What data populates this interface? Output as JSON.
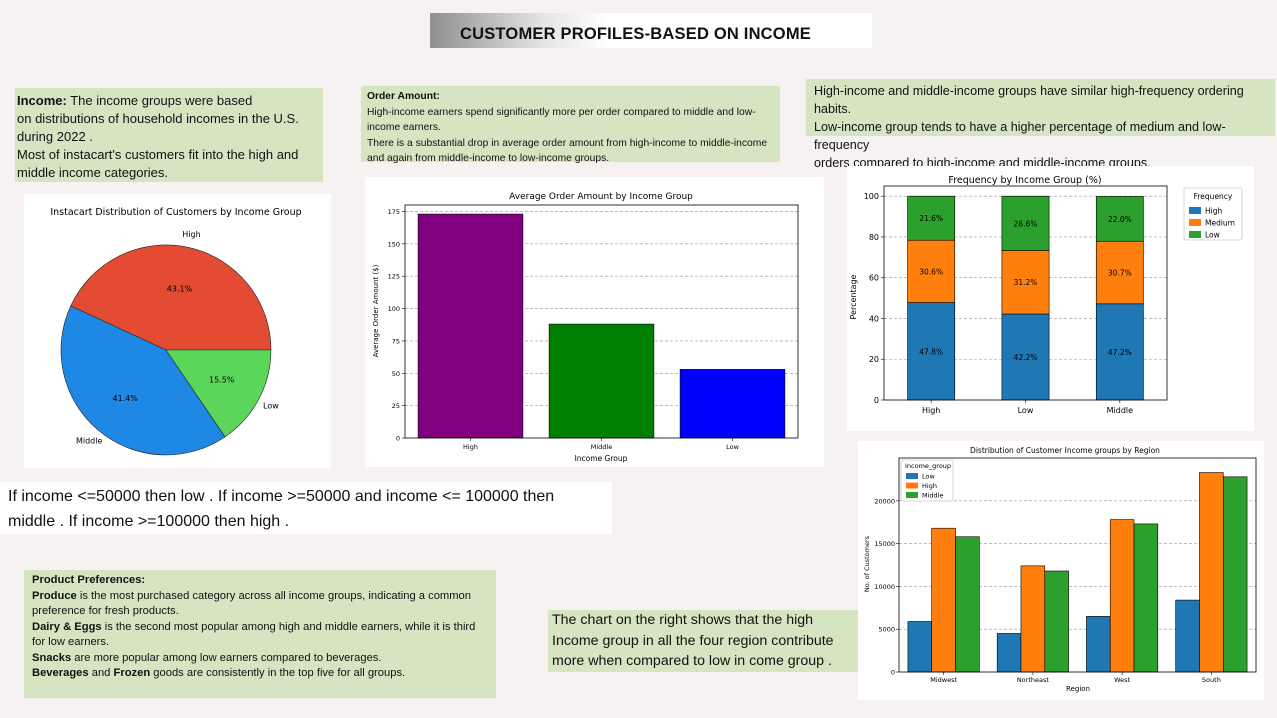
{
  "page_title": "CUSTOMER PROFILES-BASED ON INCOME",
  "income_note": {
    "heading": "Income:",
    "line1": " The income groups were based",
    "line2": "on  distributions of household incomes in the U.S.",
    "line3": "during 2022 .",
    "line4": "Most of instacart's customers fit into the high and",
    "line5": "middle income categories."
  },
  "order_note": {
    "heading": "Order Amount:",
    "line1": "High-income earners spend significantly more per order compared to middle and low-",
    "line2": "income earners.",
    "line3": "There is a substantial drop in average order amount from high-income to middle-income",
    "line4": "and again from middle-income to low-income groups."
  },
  "frequency_note": {
    "line1": "High-income and middle-income groups have similar high-frequency ordering habits.",
    "line2": "Low-income group tends to have a higher percentage of medium and low-frequency",
    "line3": "orders compared to high-income and middle-income groups."
  },
  "rule_note": {
    "line1": "If income <=50000 then low . If income >=50000 and income <= 100000 then",
    "line2": "middle . If income >=100000 then high ."
  },
  "product_note": {
    "heading": "Product Preferences:",
    "produce_bold": "Produce",
    "produce_text": " is the most purchased category across all income groups, indicating a common",
    "produce_text2": "preference for fresh products.",
    "dairy_bold": "Dairy & Eggs",
    "dairy_text": " is the second most popular among high and middle earners, while it is third",
    "dairy_text2": "for low earners.",
    "snacks_bold": "Snacks",
    "snacks_text": " are more popular among low earners compared to beverages.",
    "bev_bold": "Beverages",
    "bev_and": " and ",
    "frozen_bold": "Frozen",
    "bev_text": " goods are consistently in the top five for all groups."
  },
  "region_note": {
    "line1": "The chart on the right shows that the high",
    "line2": "Income group in all the four region contribute",
    "line3": "more when compared to low in come group ."
  },
  "chart_data": [
    {
      "type": "pie",
      "title": "Instacart Distribution of Customers by Income Group",
      "labels": [
        "High",
        "Middle",
        "Low"
      ],
      "values": [
        43.1,
        41.4,
        15.5
      ],
      "value_labels": [
        "43.1%",
        "41.4%",
        "15.5%"
      ],
      "colors": [
        "#e34c33",
        "#1f88e5",
        "#5bd65b"
      ]
    },
    {
      "type": "bar",
      "title": "Average Order Amount by Income Group",
      "categories": [
        "High",
        "Middle",
        "Low"
      ],
      "values": [
        173,
        88,
        53
      ],
      "colors": [
        "#800080",
        "#008000",
        "#0000ff"
      ],
      "xlabel": "Income Group",
      "ylabel": "Average Order Amount ($)",
      "ylim": [
        0,
        180
      ],
      "yticks": [
        0,
        25,
        50,
        75,
        100,
        125,
        150,
        175
      ],
      "grid": "horizontal dashed"
    },
    {
      "type": "bar",
      "stacked": true,
      "title": "Frequency by Income Group (%)",
      "categories": [
        "High",
        "Low",
        "Middle"
      ],
      "series": [
        {
          "name": "High",
          "values": [
            47.8,
            42.2,
            47.2
          ],
          "labels": [
            "47.8%",
            "42.2%",
            "47.2%"
          ],
          "color": "#1f77b4"
        },
        {
          "name": "Medium",
          "values": [
            30.6,
            31.2,
            30.7
          ],
          "labels": [
            "30.6%",
            "31.2%",
            "30.7%"
          ],
          "color": "#ff7f0e"
        },
        {
          "name": "Low",
          "values": [
            21.6,
            26.6,
            22.0
          ],
          "labels": [
            "21.6%",
            "26.6%",
            "22.0%"
          ],
          "color": "#2ca02c"
        }
      ],
      "ylabel": "Percentage",
      "ylim": [
        0,
        105
      ],
      "yticks": [
        0,
        20,
        40,
        60,
        80,
        100
      ],
      "legend_title": "Frequency",
      "legend_position": "right",
      "grid": "horizontal dashed"
    },
    {
      "type": "bar",
      "title": "Distribution of Customer Income groups by Region",
      "categories": [
        "Midwest",
        "Northeast",
        "West",
        "South"
      ],
      "series": [
        {
          "name": "Low",
          "values": [
            5900,
            4500,
            6500,
            8400
          ],
          "color": "#1f77b4"
        },
        {
          "name": "High",
          "values": [
            16800,
            12400,
            17800,
            23300
          ],
          "color": "#ff7f0e"
        },
        {
          "name": "Middle",
          "values": [
            15800,
            11800,
            17300,
            22800
          ],
          "color": "#2ca02c"
        }
      ],
      "xlabel": "Region",
      "ylabel": "No. of Customers",
      "ylim": [
        0,
        25000
      ],
      "yticks": [
        0,
        5000,
        10000,
        15000,
        20000
      ],
      "legend_title": "Income_group",
      "legend_position": "top-left",
      "grid": "horizontal dashed"
    }
  ]
}
